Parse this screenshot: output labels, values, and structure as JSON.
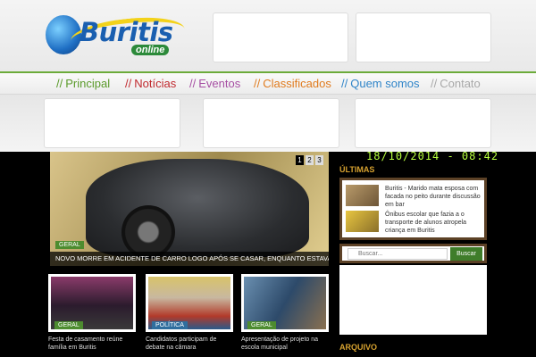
{
  "header": {
    "logo_title": "Buritis",
    "logo_sub": "online"
  },
  "nav": {
    "items": [
      {
        "label": "Principal",
        "color": "#5a9a2a"
      },
      {
        "label": "Notícias",
        "color": "#c0282d"
      },
      {
        "label": "Eventos",
        "color": "#a64fa3"
      },
      {
        "label": "Classificados",
        "color": "#e07b1e"
      },
      {
        "label": "Quem somos",
        "color": "#2f84c8"
      },
      {
        "label": "Contato",
        "color": "#a8a8a8"
      }
    ]
  },
  "slider": {
    "pages": [
      "1",
      "2",
      "3"
    ],
    "tag": "GERAL",
    "caption": "NOVO MORRE EM ACIDENTE DE CARRO LOGO APÓS SE CASAR, ENQUANTO ESTAVA A CAMI..."
  },
  "datetime": "18/10/2014 - 08:42",
  "sidebar": {
    "heading": "ÚLTIMAS",
    "news": [
      {
        "text": "Buritis - Marido mata esposa com facada no peito durante discussão em bar"
      },
      {
        "text": "Ônibus escolar que fazia a o transporte de alunos atropela criança em Buritis"
      }
    ],
    "search_placeholder": "Buscar...",
    "search_button": "Buscar",
    "heading2": "ARQUIVO"
  },
  "thumbs": [
    {
      "tag": "GERAL",
      "tag_color": "#4d8c2f",
      "title": "Festa de casamento reúne família em Buritis"
    },
    {
      "tag": "POLÍTICA",
      "tag_color": "#2f6e9e",
      "title": "Candidatos participam de debate na câmara"
    },
    {
      "tag": "GERAL",
      "tag_color": "#4d8c2f",
      "title": "Apresentação de projeto na escola municipal"
    }
  ]
}
